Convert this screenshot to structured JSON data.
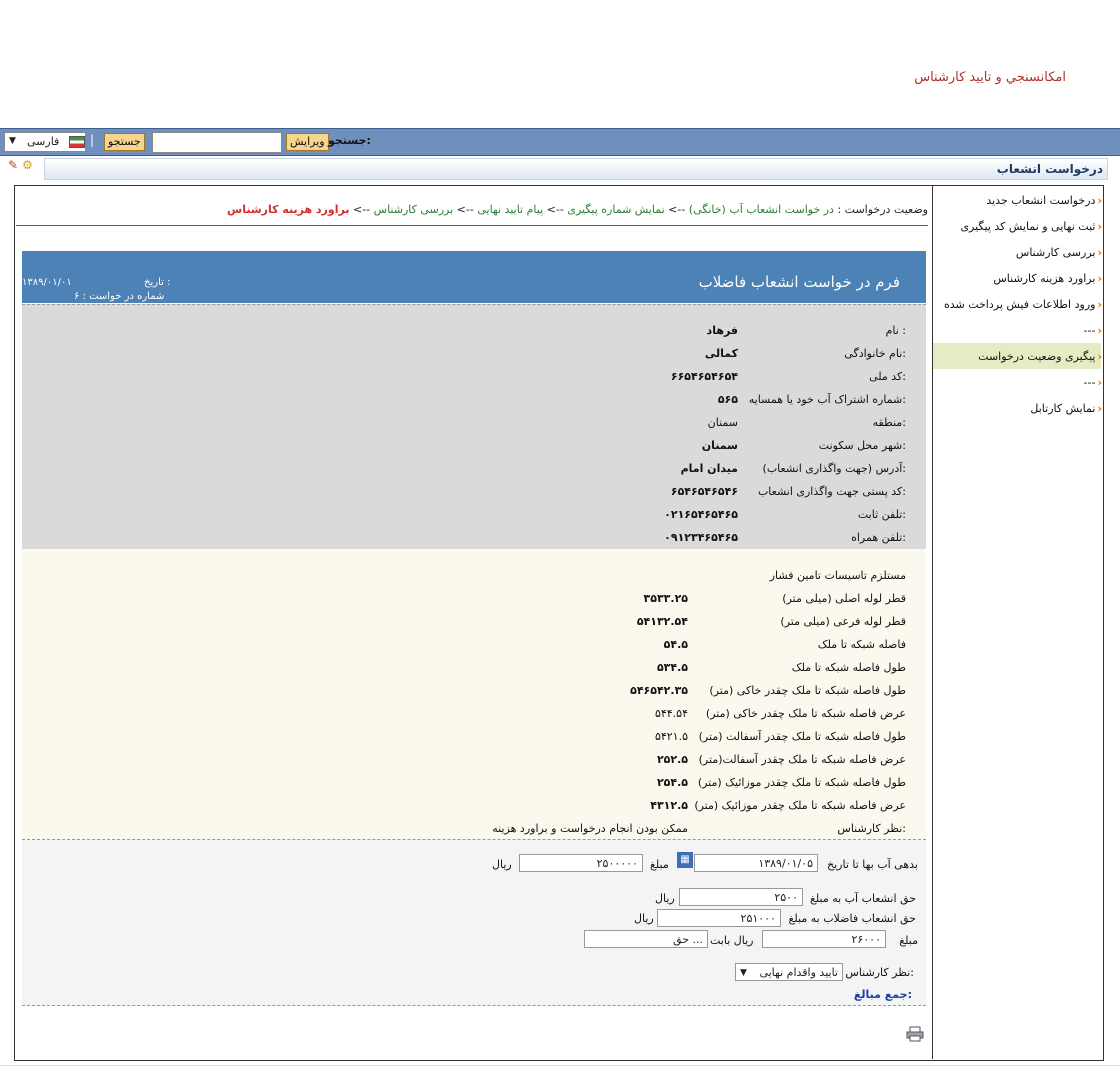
{
  "app_title": "امکانسنجي و تاييد کارشناس",
  "toolbar": {
    "language": "فارسی",
    "search_button": "جستجو",
    "edit_button": "ویرایش",
    "search_label": "جستجو:",
    "search_value": ""
  },
  "section_title": "درخواست انشعاب",
  "sidebar": {
    "items": [
      {
        "label": "درخواست انشعاب جدید"
      },
      {
        "label": "ثبت نهایی و نمایش کد پیگیری"
      },
      {
        "label": "بررسی کارشناس"
      },
      {
        "label": "براورد هزینه کارشناس"
      },
      {
        "label": "ورود اطلاعات فیش پرداخت شده"
      },
      {
        "label": "---"
      },
      {
        "label": "پیگیری وضعیت درخواست"
      },
      {
        "label": "---"
      },
      {
        "label": "نمایش کارتابل"
      }
    ]
  },
  "status": {
    "prefix": "وضعیت درخواست : ",
    "steps": [
      "در خواست انشعاب آب (خانگی)",
      "نمایش شماره پیگیری",
      "پیام تایید نهایی",
      "بررسی کارشناس"
    ],
    "current": "براورد هزینه کارشناس",
    "arrow": " --> "
  },
  "form": {
    "title": "فرم در خواست انشعاب فاضلاب",
    "date_label": "تاریخ :",
    "date_value": "۱۳۸۹/۰۱/۰۱",
    "request_no_label": "شماره در خواست :",
    "request_no_value": "۶"
  },
  "applicant": [
    {
      "label": "نام :",
      "value": "فرهاد",
      "bold": true
    },
    {
      "label": "نام خانوادگی:",
      "value": "کمالی",
      "bold": true
    },
    {
      "label": "کد ملی:",
      "value": "۶۶۵۴۶۵۴۶۵۴",
      "bold": true
    },
    {
      "label": "شماره اشتراک آب خود یا همسایه:",
      "value": "۵۶۵",
      "bold": true
    },
    {
      "label": "منطقه:",
      "value": "سمنان",
      "bold": false
    },
    {
      "label": "شهر محل سکونت:",
      "value": "سمنان",
      "bold": true
    },
    {
      "label": "آدرس (جهت واگذاری انشعاب):",
      "value": "میدان امام",
      "bold": true
    },
    {
      "label": "کد پستی جهت واگذاری انشعاب:",
      "value": "۶۵۴۶۵۴۶۵۴۶",
      "bold": true
    },
    {
      "label": "تلفن ثابت:",
      "value": "۰۲۱۶۵۴۶۵۴۶۵",
      "bold": true
    },
    {
      "label": "تلفن همراه:",
      "value": "۰۹۱۲۳۴۶۵۴۶۵",
      "bold": true
    }
  ],
  "technical": {
    "heading": "مستلزم تاسیسات تامین فشار",
    "rows": [
      {
        "label": "قطر لوله اصلی (میلی متر)",
        "value": "۳۵۳۳.۲۵",
        "bold": true
      },
      {
        "label": "قطر لوله فرعی (میلی متر)",
        "value": "۵۴۱۳۲.۵۴",
        "bold": true
      },
      {
        "label": "فاصله شبکه تا ملک",
        "value": "۵۴.۵",
        "bold": true
      },
      {
        "label": "طول فاصله شبکه تا ملک",
        "value": "۵۳۴.۵",
        "bold": true
      },
      {
        "label": "طول فاصله شبکه تا ملک چقدر خاکی (متر)",
        "value": "۵۴۶۵۴۲.۳۵",
        "bold": true
      },
      {
        "label": "عرض فاصله شبکه تا ملک چقدر خاکی (متر)",
        "value": "۵۴۴.۵۴",
        "bold": false
      },
      {
        "label": "طول فاصله شبکه تا ملک چقدر آسفالت (متر)",
        "value": "۵۴۲۱.۵",
        "bold": false
      },
      {
        "label": "عرض فاصله شبکه تا ملک چقدر آسفالت(متر)",
        "value": "۲۵۲.۵",
        "bold": true
      },
      {
        "label": "طول فاصله شبکه تا ملک چقدر موزائیک (متر)",
        "value": "۲۵۴.۵",
        "bold": true
      },
      {
        "label": "عرض فاصله شبکه تا ملک چقدر موزائیک (متر)",
        "value": "۴۳۱۲.۵",
        "bold": true
      }
    ],
    "expert_opinion_label": "نظر کارشناس:",
    "expert_opinion_value": "ممکن بودن انجام درخواست و براورد هزینه"
  },
  "fees": {
    "debt_label": "بدهی آب بها تا تاریخ",
    "debt_date": "۱۳۸۹/۰۱/۰۵",
    "amount_label": "مبلغ",
    "debt_amount": "۲۵۰۰۰۰۰",
    "rial": "ریال",
    "water_label": "حق انشعاب آب به مبلغ",
    "water_amount": "۲۵۰۰",
    "sewer_label": "حق انشعاب فاضلاب به مبلغ",
    "sewer_amount": "۲۵۱۰۰۰",
    "other_amount_label": "مبلغ",
    "other_amount": "۲۶۰۰۰",
    "other_rial_label": "ریال بابت",
    "other_reason": "حق ...",
    "opinion_label": "نظر کارشناس:",
    "opinion_value": "تایید واقدام نهایی",
    "total_label": "جمع مبالغ:"
  },
  "colors": {
    "banner": "#4c82b6",
    "toolbar": "#6f8fbd",
    "accent_red": "#d32f2f",
    "accent_green": "#2e7d32"
  }
}
